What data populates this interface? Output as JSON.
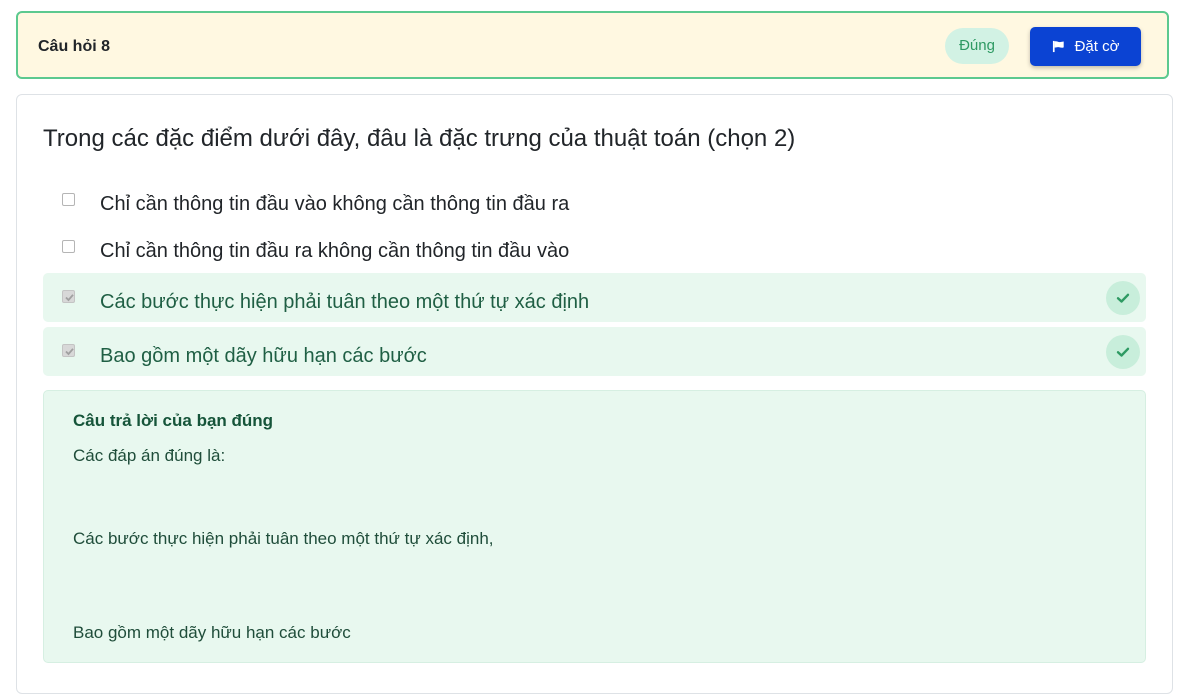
{
  "question": {
    "title": "Câu hỏi 8",
    "status": "Đúng",
    "flag_label": "Đặt cờ",
    "text": "Trong các đặc điểm dưới đây, đâu là đặc trưng của thuật toán (chọn 2)",
    "options": [
      {
        "label": "Chỉ cần thông tin đầu vào không cần thông tin đầu ra",
        "checked": false,
        "correct": false
      },
      {
        "label": "Chỉ cần thông tin đầu ra không cần thông tin đầu vào",
        "checked": false,
        "correct": false
      },
      {
        "label": "Các bước thực hiện phải tuân theo một thứ tự xác định",
        "checked": true,
        "correct": true
      },
      {
        "label": "Bao gồm một dãy hữu hạn các bước",
        "checked": true,
        "correct": true
      }
    ]
  },
  "feedback": {
    "title": "Câu trả lời của bạn đúng",
    "intro": "Các đáp án đúng là:",
    "answers": [
      "Các bước thực hiện phải tuân theo một thứ tự xác định,",
      "Bao gồm một dãy hữu hạn các bước"
    ]
  },
  "colors": {
    "header_bg": "#fff8e1",
    "header_border": "#5cc98f",
    "accent_button": "#0b43d3",
    "correct_bg": "#e8f8ef",
    "correct_check": "#2e9a63"
  },
  "icons": {
    "flag_button": "flag-icon",
    "correct_mark": "check-icon"
  }
}
